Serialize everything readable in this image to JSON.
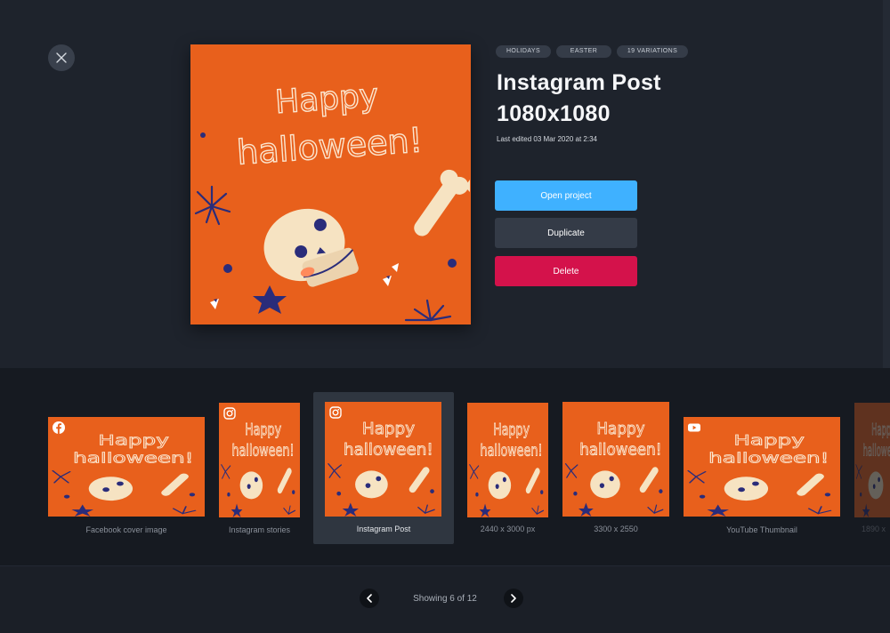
{
  "tags": [
    "HOLIDAYS",
    "EASTER",
    "19 VARIATIONS"
  ],
  "title_line1": "Instagram Post",
  "title_line2": "1080x1080",
  "last_edited": "Last edited 03 Mar 2020 at 2:34",
  "buttons": {
    "open": "Open project",
    "duplicate": "Duplicate",
    "delete": "Delete"
  },
  "artwork": {
    "line1": "Happy",
    "line2": "halloween!"
  },
  "colors": {
    "accent": "#3fb1ff",
    "danger": "#d4124b",
    "artwork_bg": "#e8601c",
    "star": "#2a2c7a",
    "bone": "#f6e3c2"
  },
  "variations": [
    {
      "label": "Facebook cover image",
      "icon": "facebook-icon"
    },
    {
      "label": "Instagram stories",
      "icon": "instagram-icon"
    },
    {
      "label": "Instagram Post",
      "icon": "instagram-icon"
    },
    {
      "label": "2440 x 3000 px",
      "icon": ""
    },
    {
      "label": "3300 x 2550",
      "icon": ""
    },
    {
      "label": "YouTube Thumbnail",
      "icon": "youtube-icon"
    },
    {
      "label": "1890 x",
      "icon": ""
    }
  ],
  "pagination": {
    "text": "Showing 6 of 12"
  }
}
